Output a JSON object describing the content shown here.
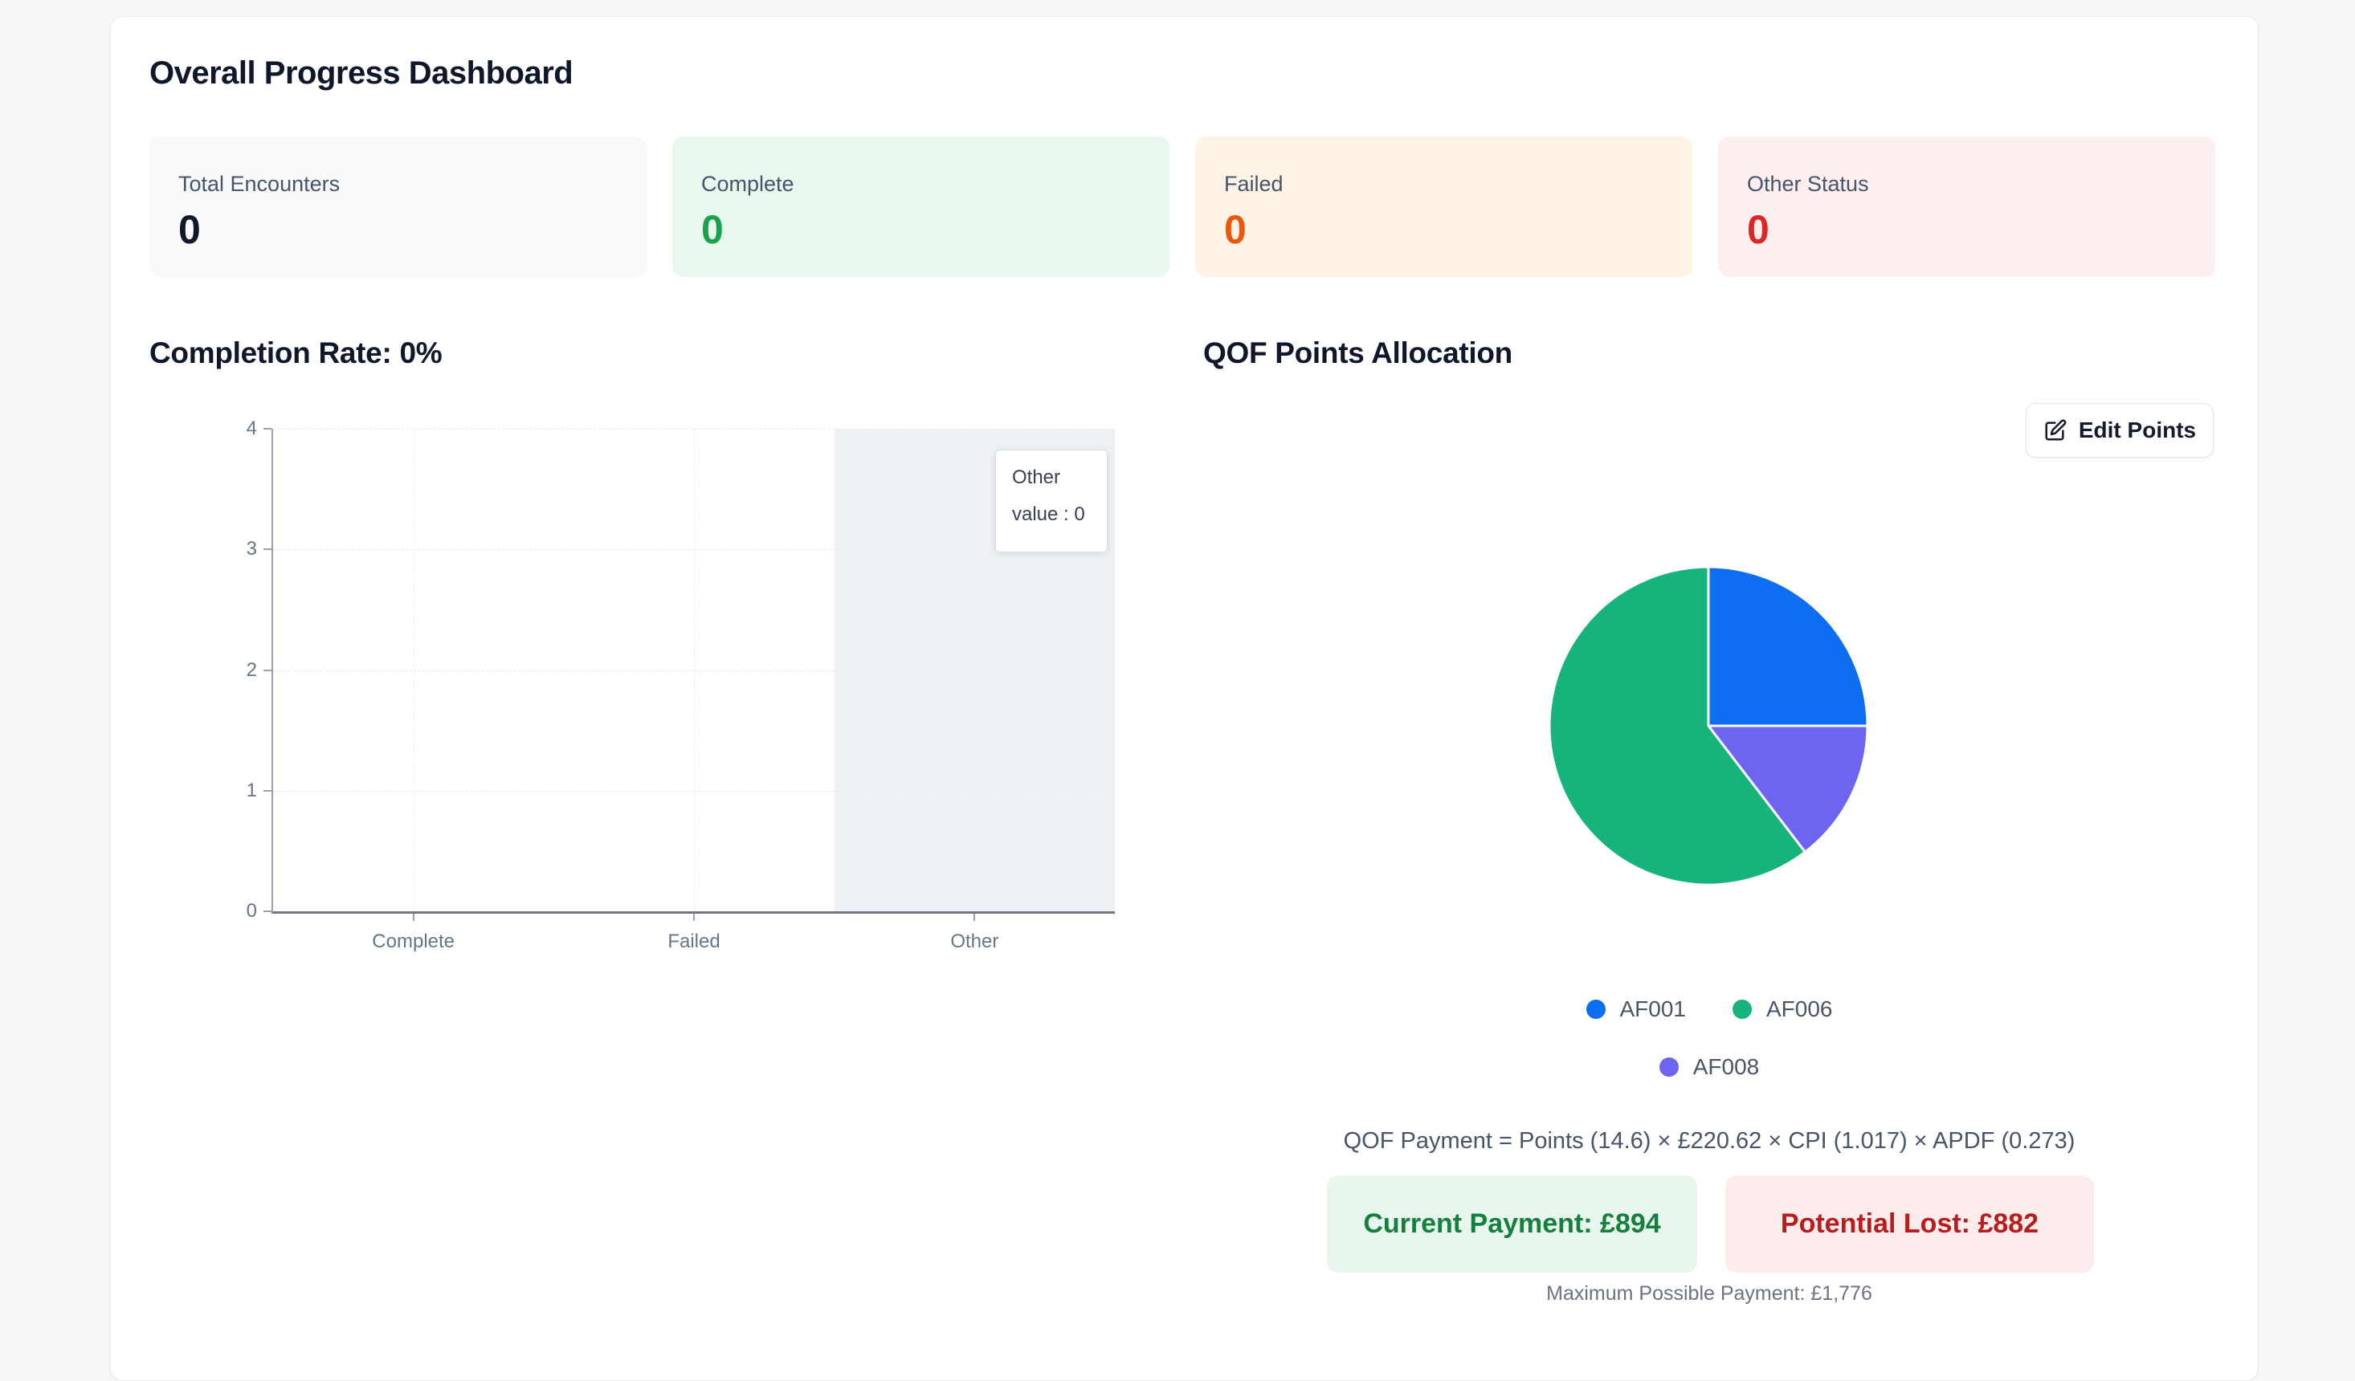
{
  "page": {
    "title": "Overall Progress Dashboard"
  },
  "colors": {
    "page_background": "#f5f7f9",
    "panel_background": "#ffffff",
    "highlight_band": "#eef1f6",
    "current_payment_bg": "#e9f6ee",
    "current_payment_text": "#15803d",
    "potential_lost_bg": "#fcecec",
    "potential_lost_text": "#b91c1c"
  },
  "stats": {
    "cards": [
      {
        "label": "Total Encounters",
        "value": "0",
        "bg": "#f8f9fb",
        "value_color": "#111827"
      },
      {
        "label": "Complete",
        "value": "0",
        "bg": "#e9f8ef",
        "value_color": "#16a34a"
      },
      {
        "label": "Failed",
        "value": "0",
        "bg": "#fdf3e6",
        "value_color": "#ea580c"
      },
      {
        "label": "Other Status",
        "value": "0",
        "bg": "#fdeef0",
        "value_color": "#dc2626"
      }
    ]
  },
  "left_section": {
    "heading": "Completion Rate: 0%"
  },
  "right_section": {
    "heading": "QOF Points Allocation",
    "edit_button_label": "Edit Points",
    "formula": "QOF Payment = Points (14.6) × £220.62 × CPI (1.017) × APDF (0.273)",
    "current_payment": "Current Payment: £894",
    "potential_lost": "Potential Lost: £882",
    "max_payment": "Maximum Possible Payment: £1,776"
  },
  "chart_data": [
    {
      "type": "bar",
      "title": "Completion Rate: 0%",
      "categories": [
        "Complete",
        "Failed",
        "Other"
      ],
      "values": [
        0,
        0,
        0
      ],
      "series_name": "value",
      "xlabel": "",
      "ylabel": "",
      "ylim": [
        0,
        4
      ],
      "y_ticks": [
        0,
        1,
        2,
        3,
        4
      ],
      "grid": true,
      "legend_position": "none",
      "highlighted_category": "Other",
      "tooltip": {
        "title": "Other",
        "line": "value : 0"
      }
    },
    {
      "type": "pie",
      "title": "QOF Points Allocation",
      "slices": [
        {
          "label": "AF001",
          "pct": 25.0,
          "color": "#0d6ef2"
        },
        {
          "label": "AF006",
          "pct": 60.4,
          "color": "#16b47b"
        },
        {
          "label": "AF008",
          "pct": 14.6,
          "color": "#6d65ef"
        }
      ],
      "draw_order": [
        "AF001",
        "AF008",
        "AF006"
      ],
      "legend_position": "bottom"
    }
  ]
}
